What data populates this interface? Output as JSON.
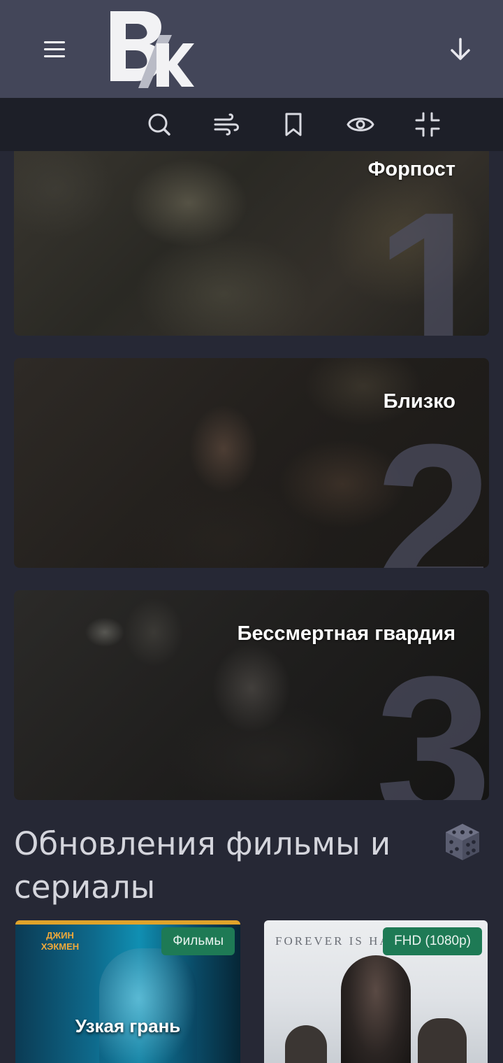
{
  "header": {
    "logo_alt": "BK",
    "colors": {
      "background": "#434659",
      "toolbar": "#1d1f28",
      "page": "#262835"
    }
  },
  "toolbar": {
    "icons": [
      "search-icon",
      "wind-filter-icon",
      "bookmark-icon",
      "eye-icon",
      "collapse-icon"
    ]
  },
  "slides": [
    {
      "title": "Форпост",
      "number": "1"
    },
    {
      "title": "Близко",
      "number": "2"
    },
    {
      "title": "Бессмертная гвардия",
      "number": "3"
    }
  ],
  "section": {
    "title": "Обновления фильмы и сериалы"
  },
  "cards": [
    {
      "badge": "Фильмы",
      "title": "Узкая грань",
      "poster_text": "ДЖИН ХЭКМЕН"
    },
    {
      "badge": "FHD (1080p)",
      "title": "",
      "poster_text": "FOREVER IS HARDER"
    }
  ],
  "accent_color": "#1e7a55"
}
